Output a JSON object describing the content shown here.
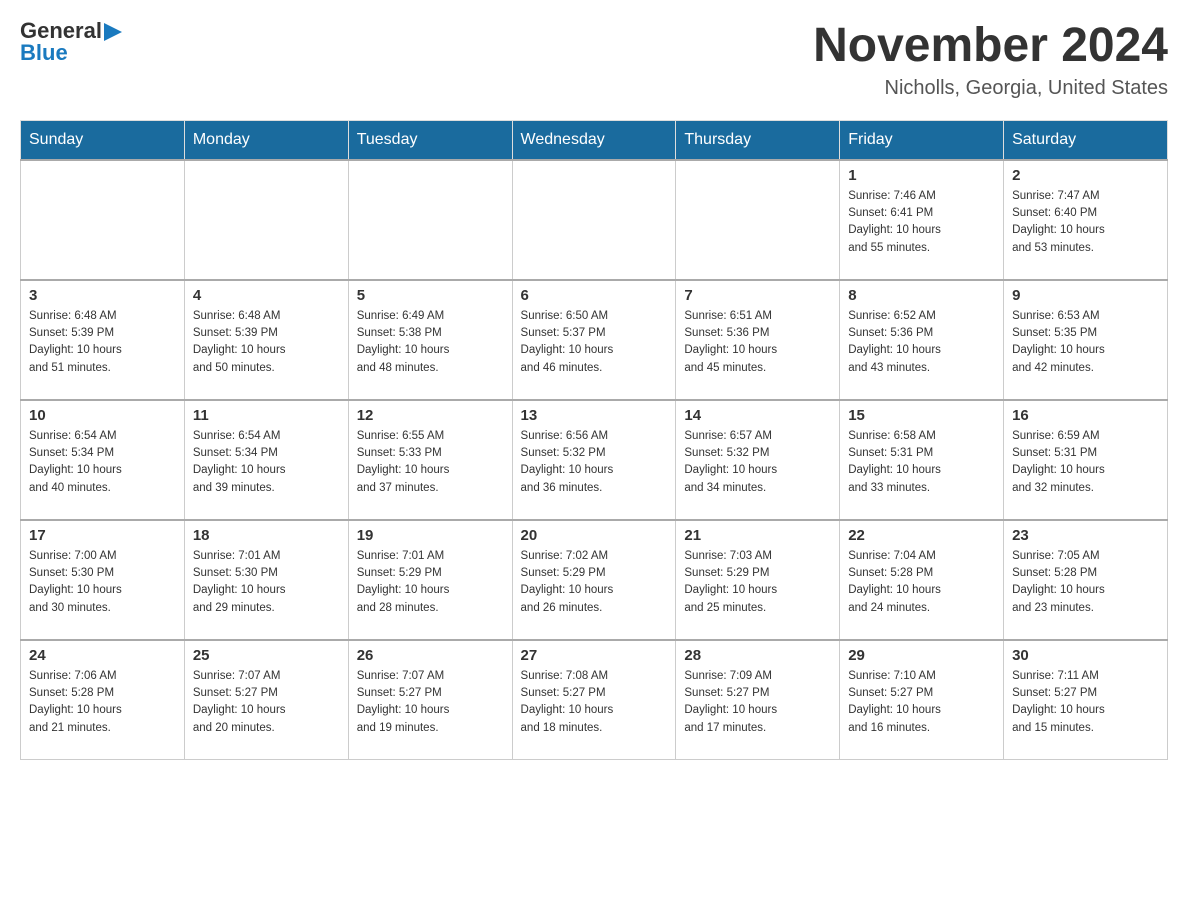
{
  "logo": {
    "general": "General",
    "blue": "Blue",
    "arrow": "▶"
  },
  "title": "November 2024",
  "location": "Nicholls, Georgia, United States",
  "weekdays": [
    "Sunday",
    "Monday",
    "Tuesday",
    "Wednesday",
    "Thursday",
    "Friday",
    "Saturday"
  ],
  "weeks": [
    [
      {
        "day": "",
        "info": ""
      },
      {
        "day": "",
        "info": ""
      },
      {
        "day": "",
        "info": ""
      },
      {
        "day": "",
        "info": ""
      },
      {
        "day": "",
        "info": ""
      },
      {
        "day": "1",
        "info": "Sunrise: 7:46 AM\nSunset: 6:41 PM\nDaylight: 10 hours\nand 55 minutes."
      },
      {
        "day": "2",
        "info": "Sunrise: 7:47 AM\nSunset: 6:40 PM\nDaylight: 10 hours\nand 53 minutes."
      }
    ],
    [
      {
        "day": "3",
        "info": "Sunrise: 6:48 AM\nSunset: 5:39 PM\nDaylight: 10 hours\nand 51 minutes."
      },
      {
        "day": "4",
        "info": "Sunrise: 6:48 AM\nSunset: 5:39 PM\nDaylight: 10 hours\nand 50 minutes."
      },
      {
        "day": "5",
        "info": "Sunrise: 6:49 AM\nSunset: 5:38 PM\nDaylight: 10 hours\nand 48 minutes."
      },
      {
        "day": "6",
        "info": "Sunrise: 6:50 AM\nSunset: 5:37 PM\nDaylight: 10 hours\nand 46 minutes."
      },
      {
        "day": "7",
        "info": "Sunrise: 6:51 AM\nSunset: 5:36 PM\nDaylight: 10 hours\nand 45 minutes."
      },
      {
        "day": "8",
        "info": "Sunrise: 6:52 AM\nSunset: 5:36 PM\nDaylight: 10 hours\nand 43 minutes."
      },
      {
        "day": "9",
        "info": "Sunrise: 6:53 AM\nSunset: 5:35 PM\nDaylight: 10 hours\nand 42 minutes."
      }
    ],
    [
      {
        "day": "10",
        "info": "Sunrise: 6:54 AM\nSunset: 5:34 PM\nDaylight: 10 hours\nand 40 minutes."
      },
      {
        "day": "11",
        "info": "Sunrise: 6:54 AM\nSunset: 5:34 PM\nDaylight: 10 hours\nand 39 minutes."
      },
      {
        "day": "12",
        "info": "Sunrise: 6:55 AM\nSunset: 5:33 PM\nDaylight: 10 hours\nand 37 minutes."
      },
      {
        "day": "13",
        "info": "Sunrise: 6:56 AM\nSunset: 5:32 PM\nDaylight: 10 hours\nand 36 minutes."
      },
      {
        "day": "14",
        "info": "Sunrise: 6:57 AM\nSunset: 5:32 PM\nDaylight: 10 hours\nand 34 minutes."
      },
      {
        "day": "15",
        "info": "Sunrise: 6:58 AM\nSunset: 5:31 PM\nDaylight: 10 hours\nand 33 minutes."
      },
      {
        "day": "16",
        "info": "Sunrise: 6:59 AM\nSunset: 5:31 PM\nDaylight: 10 hours\nand 32 minutes."
      }
    ],
    [
      {
        "day": "17",
        "info": "Sunrise: 7:00 AM\nSunset: 5:30 PM\nDaylight: 10 hours\nand 30 minutes."
      },
      {
        "day": "18",
        "info": "Sunrise: 7:01 AM\nSunset: 5:30 PM\nDaylight: 10 hours\nand 29 minutes."
      },
      {
        "day": "19",
        "info": "Sunrise: 7:01 AM\nSunset: 5:29 PM\nDaylight: 10 hours\nand 28 minutes."
      },
      {
        "day": "20",
        "info": "Sunrise: 7:02 AM\nSunset: 5:29 PM\nDaylight: 10 hours\nand 26 minutes."
      },
      {
        "day": "21",
        "info": "Sunrise: 7:03 AM\nSunset: 5:29 PM\nDaylight: 10 hours\nand 25 minutes."
      },
      {
        "day": "22",
        "info": "Sunrise: 7:04 AM\nSunset: 5:28 PM\nDaylight: 10 hours\nand 24 minutes."
      },
      {
        "day": "23",
        "info": "Sunrise: 7:05 AM\nSunset: 5:28 PM\nDaylight: 10 hours\nand 23 minutes."
      }
    ],
    [
      {
        "day": "24",
        "info": "Sunrise: 7:06 AM\nSunset: 5:28 PM\nDaylight: 10 hours\nand 21 minutes."
      },
      {
        "day": "25",
        "info": "Sunrise: 7:07 AM\nSunset: 5:27 PM\nDaylight: 10 hours\nand 20 minutes."
      },
      {
        "day": "26",
        "info": "Sunrise: 7:07 AM\nSunset: 5:27 PM\nDaylight: 10 hours\nand 19 minutes."
      },
      {
        "day": "27",
        "info": "Sunrise: 7:08 AM\nSunset: 5:27 PM\nDaylight: 10 hours\nand 18 minutes."
      },
      {
        "day": "28",
        "info": "Sunrise: 7:09 AM\nSunset: 5:27 PM\nDaylight: 10 hours\nand 17 minutes."
      },
      {
        "day": "29",
        "info": "Sunrise: 7:10 AM\nSunset: 5:27 PM\nDaylight: 10 hours\nand 16 minutes."
      },
      {
        "day": "30",
        "info": "Sunrise: 7:11 AM\nSunset: 5:27 PM\nDaylight: 10 hours\nand 15 minutes."
      }
    ]
  ]
}
